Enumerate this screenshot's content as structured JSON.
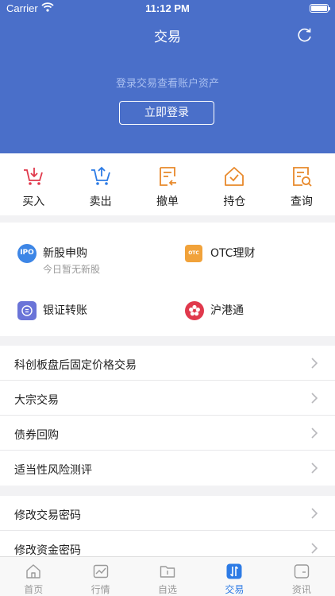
{
  "status_bar": {
    "carrier": "Carrier",
    "time": "11:12 PM"
  },
  "header": {
    "title": "交易",
    "login_hint": "登录交易查看账户资产",
    "login_button": "立即登录"
  },
  "quick_actions": [
    {
      "label": "买入",
      "icon": "cart-in-icon",
      "color": "#e0394c"
    },
    {
      "label": "卖出",
      "icon": "cart-out-icon",
      "color": "#2d7be5"
    },
    {
      "label": "撤单",
      "icon": "cancel-order-icon",
      "color": "#e8892b"
    },
    {
      "label": "持仓",
      "icon": "position-house-icon",
      "color": "#e8892b"
    },
    {
      "label": "查询",
      "icon": "query-doc-icon",
      "color": "#e8892b"
    }
  ],
  "services": {
    "ipo": {
      "title": "新股申购",
      "subtitle": "今日暂无新股",
      "icon_text": "IPO"
    },
    "otc": {
      "title": "OTC理财",
      "icon_text": "OTC"
    },
    "bank": {
      "title": "银证转账"
    },
    "hk": {
      "title": "沪港通"
    }
  },
  "trade_list": [
    "科创板盘后固定价格交易",
    "大宗交易",
    "债券回购",
    "适当性风险测评"
  ],
  "password_list": [
    "修改交易密码",
    "修改资金密码"
  ],
  "tabbar": [
    {
      "label": "首页",
      "icon": "home-icon"
    },
    {
      "label": "行情",
      "icon": "market-chart-icon"
    },
    {
      "label": "自选",
      "icon": "watchlist-folder-icon"
    },
    {
      "label": "交易",
      "icon": "trade-icon",
      "active": true
    },
    {
      "label": "资讯",
      "icon": "news-icon"
    }
  ]
}
